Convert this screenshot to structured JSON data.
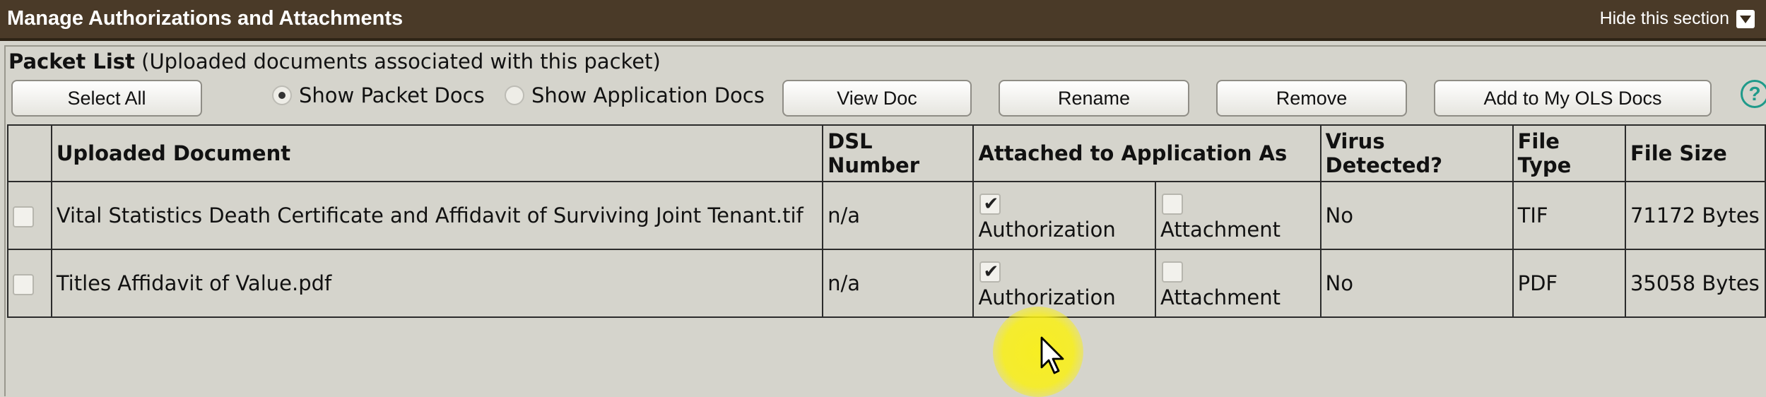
{
  "header": {
    "title": "Manage Authorizations and Attachments",
    "hide_label": "Hide this section"
  },
  "packet": {
    "title_bold": "Packet List",
    "title_rest": " (Uploaded documents associated with this packet)"
  },
  "toolbar": {
    "select_all": "Select All",
    "radio_packet": "Show Packet Docs",
    "radio_application": "Show Application Docs",
    "view_doc": "View Doc",
    "rename": "Rename",
    "remove": "Remove",
    "add_to_ols": "Add to My OLS Docs",
    "help": "?"
  },
  "table": {
    "headers": {
      "uploaded_document": "Uploaded Document",
      "dsl_number_1": "DSL",
      "dsl_number_2": "Number",
      "attached_as": "Attached to Application As",
      "virus_1": "Virus",
      "virus_2": "Detected?",
      "file_type_1": "File",
      "file_type_2": "Type",
      "file_size": "File Size"
    },
    "rows": [
      {
        "document": "Vital Statistics Death Certificate and Affidavit of Surviving Joint Tenant.tif",
        "dsl": "n/a",
        "authorization_label": "Authorization",
        "authorization_checked": true,
        "attachment_label": "Attachment",
        "attachment_checked": false,
        "virus": "No",
        "file_type": "TIF",
        "file_size": "71172 Bytes"
      },
      {
        "document": "Titles Affidavit of Value.pdf",
        "dsl": "n/a",
        "authorization_label": "Authorization",
        "authorization_checked": true,
        "attachment_label": "Attachment",
        "attachment_checked": false,
        "virus": "No",
        "file_type": "PDF",
        "file_size": "35058 Bytes"
      }
    ]
  },
  "colors": {
    "header_bg": "#4a3a28",
    "panel_bg": "#d5d4cc",
    "help_accent": "#1f9a8a",
    "cursor_highlight": "#f5ea14"
  }
}
